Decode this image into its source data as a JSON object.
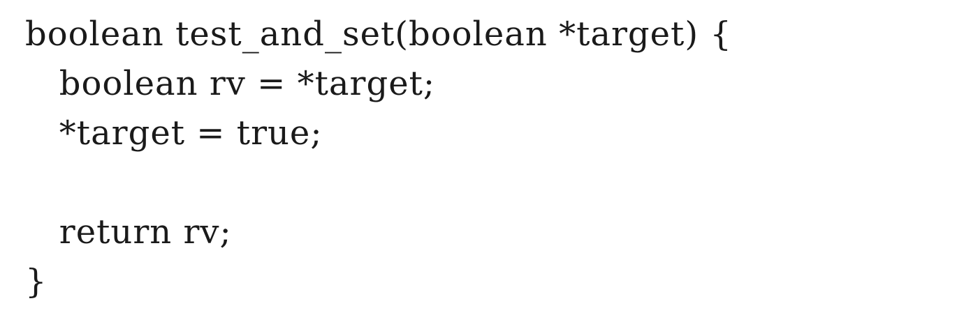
{
  "code": {
    "lines": [
      "boolean test_and_set(boolean *target) {",
      "   boolean rv = *target;",
      "   *target = true;",
      "",
      "   return rv;",
      "}"
    ]
  }
}
